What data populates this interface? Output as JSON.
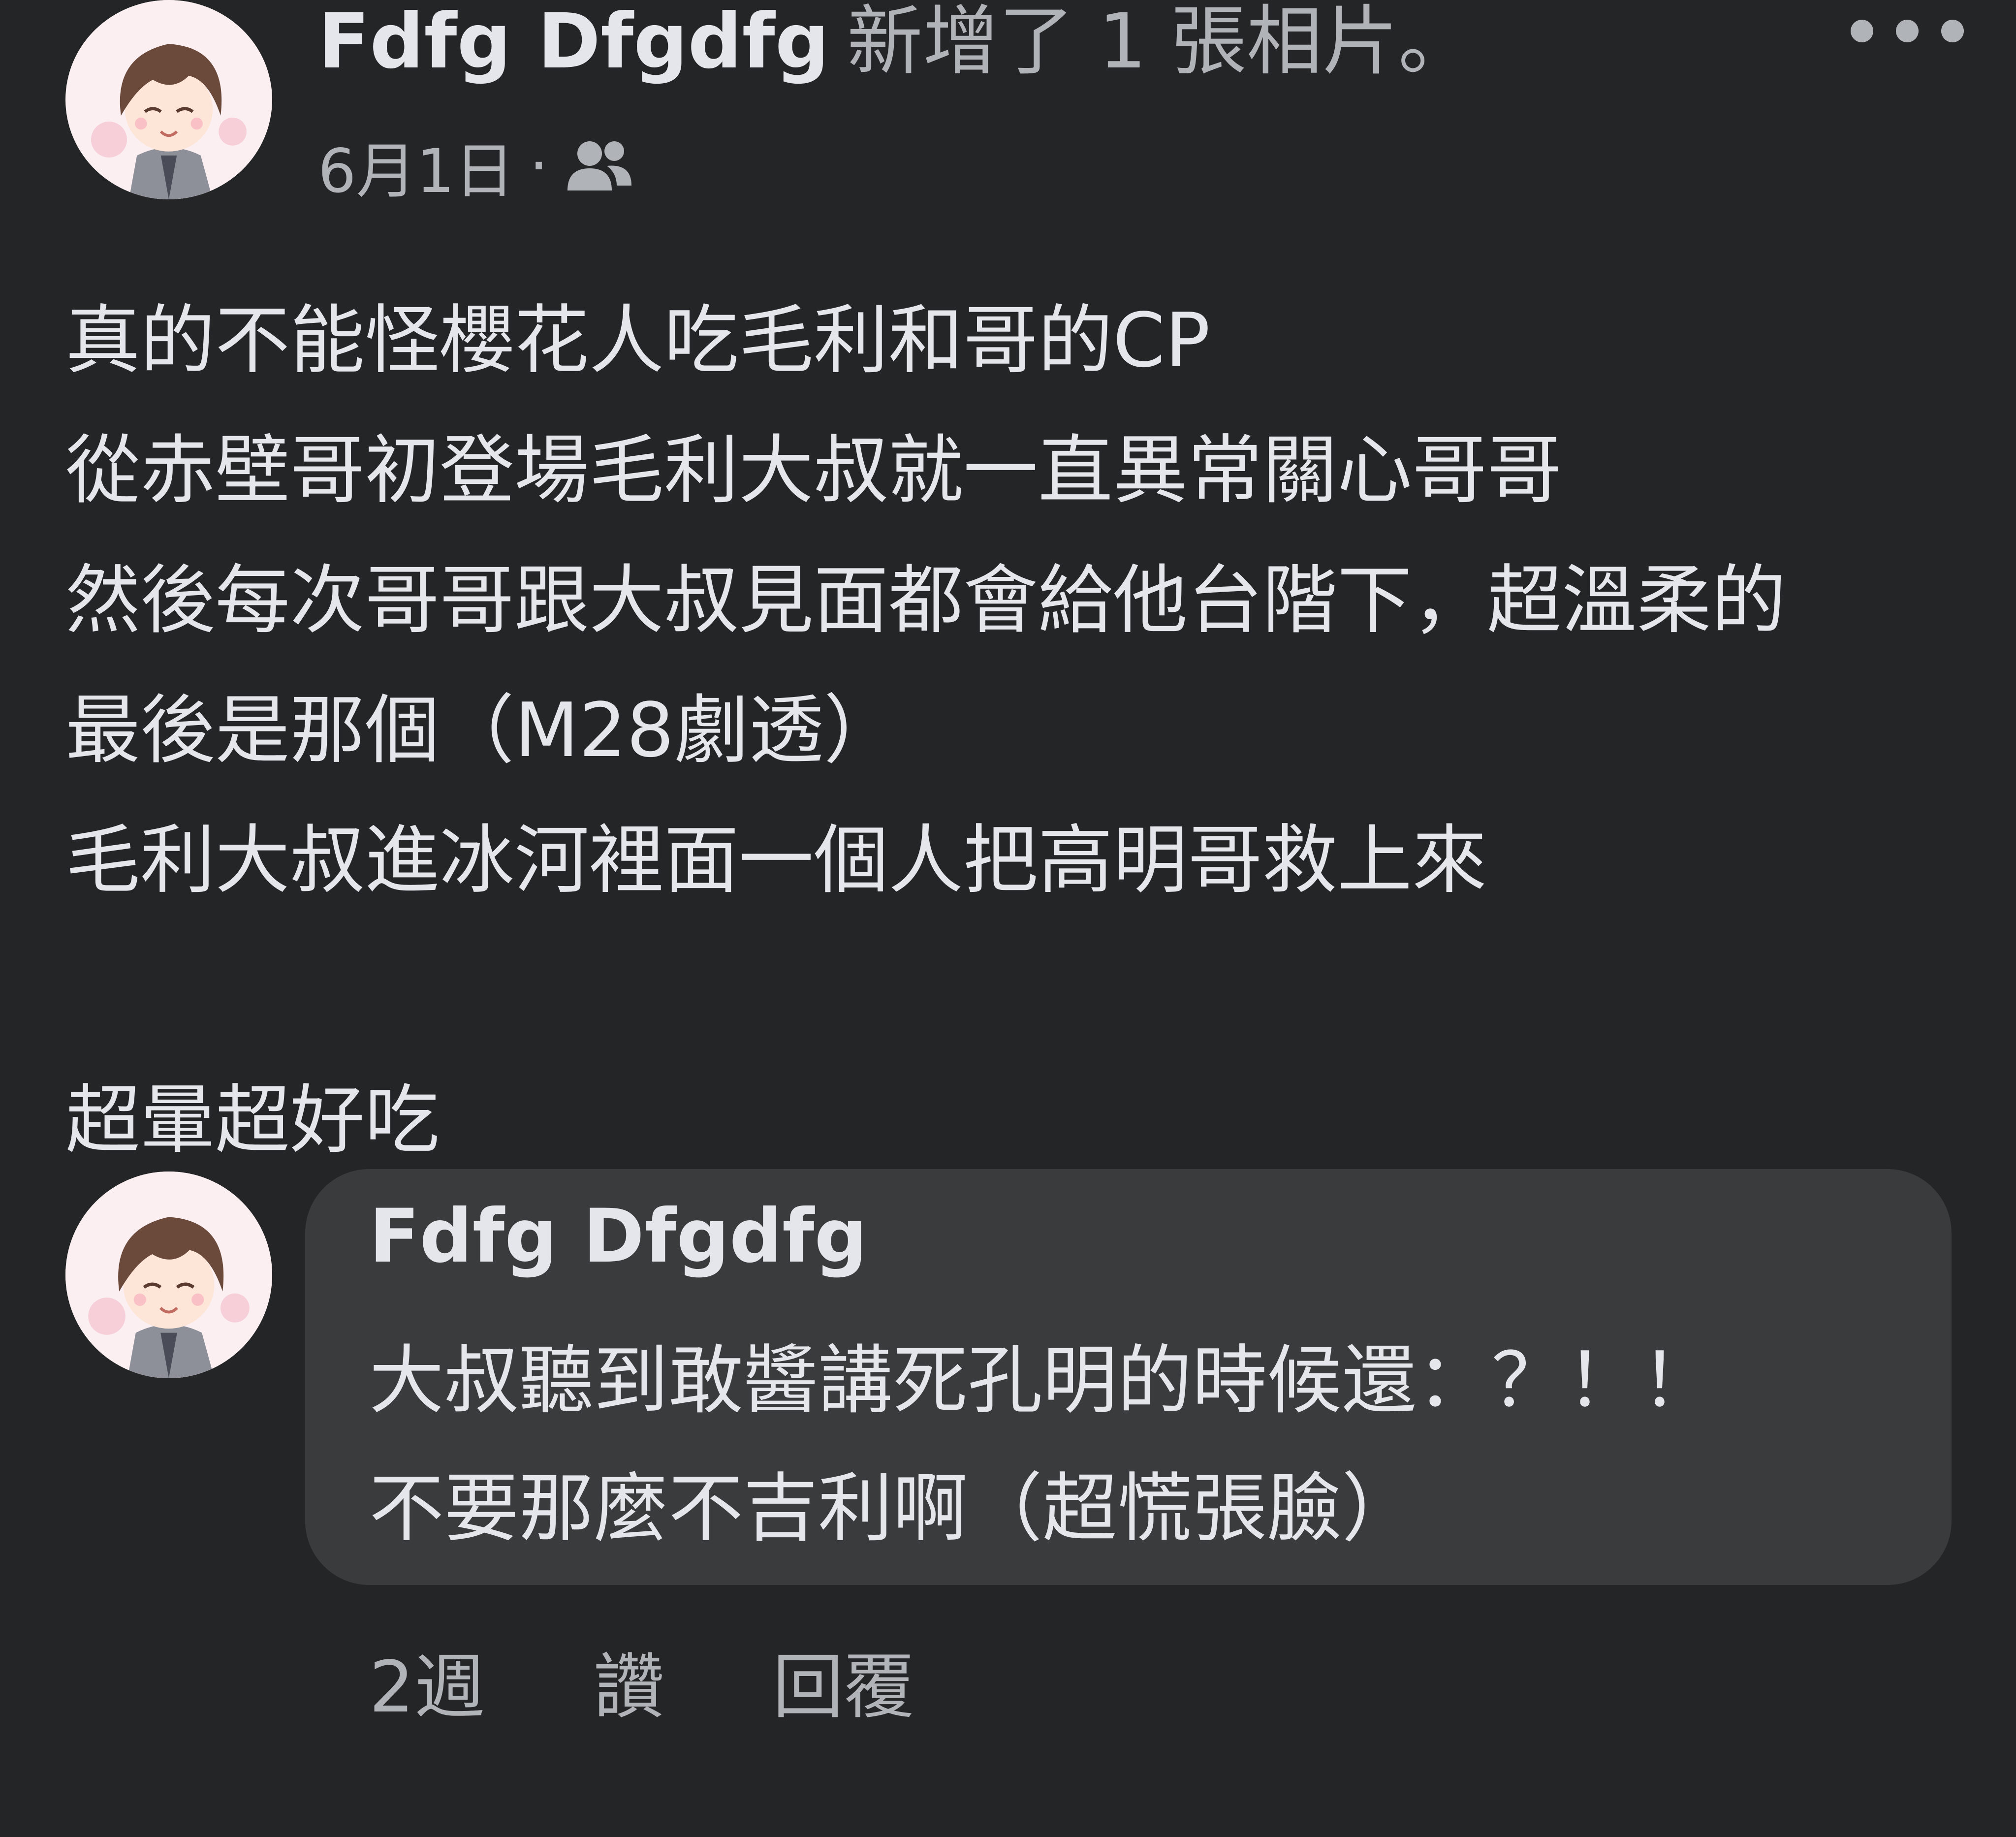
{
  "post": {
    "author": "Fdfg Dfgdfg",
    "action": "新增了 1 張相片。",
    "date": "6月1日",
    "separator": "·",
    "audience_icon": "friends-icon",
    "more_icon": "more-horizontal-icon",
    "lines": [
      "真的不能怪櫻花人吃毛利和哥的CP",
      "從赤壁哥初登場毛利大叔就一直異常關心哥哥",
      "然後每次哥哥跟大叔見面都會給他台階下，超溫柔的",
      "最後是那個（M28劇透）",
      "毛利大叔進冰河裡面一個人把高明哥救上來",
      "",
      "超暈超好吃"
    ]
  },
  "comment": {
    "author": "Fdfg Dfgdfg",
    "lines": [
      "大叔聽到敢醬講死孔明的時候還：？！！",
      "不要那麼不吉利啊（超慌張臉）"
    ],
    "time": "2週",
    "like_label": "讚",
    "reply_label": "回覆"
  },
  "colors": {
    "background": "#242526",
    "bubble": "#3a3b3c",
    "primary_text": "#e4e6eb",
    "secondary_text": "#b0b3b8"
  }
}
